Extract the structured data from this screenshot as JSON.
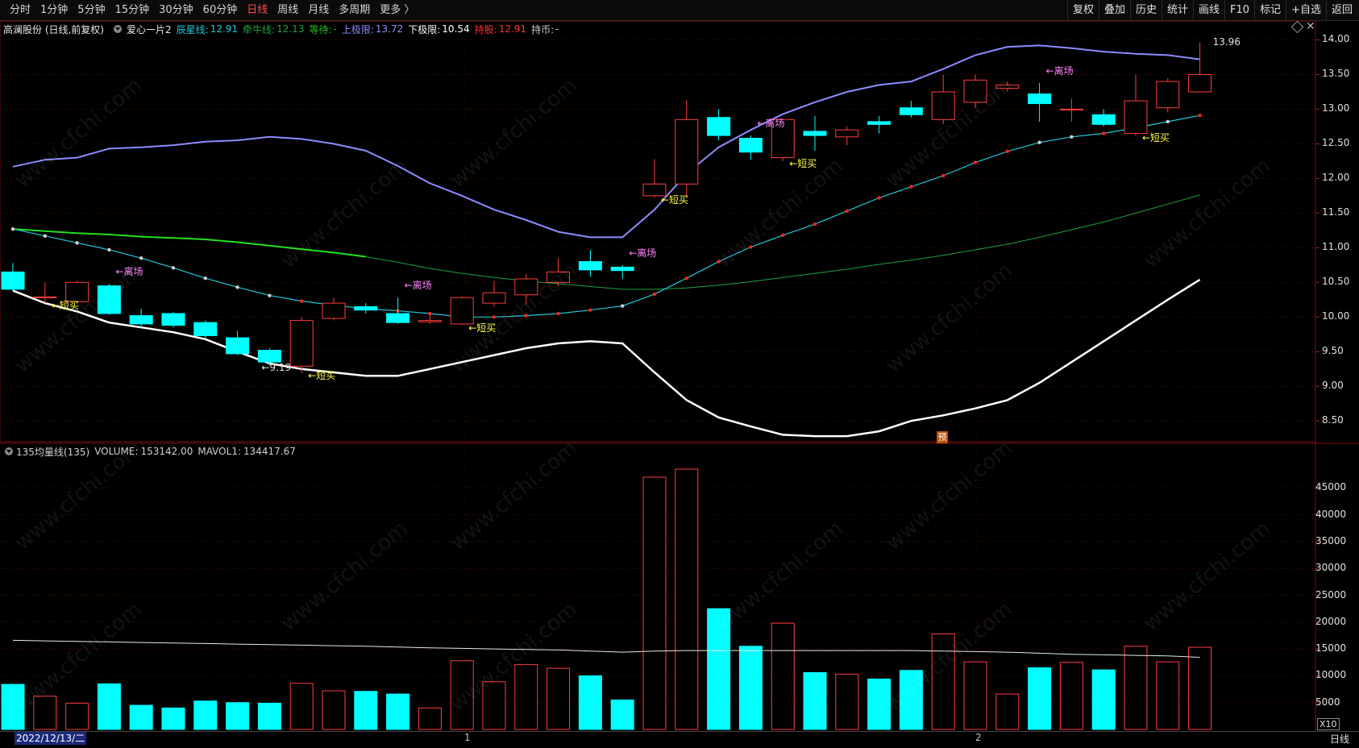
{
  "toolbar": {
    "left": [
      {
        "label": "分时",
        "active": false
      },
      {
        "label": "1分钟",
        "active": false
      },
      {
        "label": "5分钟",
        "active": false
      },
      {
        "label": "15分钟",
        "active": false
      },
      {
        "label": "30分钟",
        "active": false
      },
      {
        "label": "60分钟",
        "active": false
      },
      {
        "label": "日线",
        "active": true
      },
      {
        "label": "周线",
        "active": false
      },
      {
        "label": "月线",
        "active": false
      },
      {
        "label": "多周期",
        "active": false
      },
      {
        "label": "更多 〉",
        "active": false
      }
    ],
    "right": [
      "复权",
      "叠加",
      "历史",
      "统计",
      "画线",
      "F10",
      "标记",
      "+自选",
      "返回"
    ]
  },
  "info": {
    "stock": "高澜股份 (日线,前复权)",
    "indicator": "爱心一片2",
    "chenxing_label": "辰星线:",
    "chenxing_value": "12.91",
    "qianniu_label": "牵牛线:",
    "qianniu_value": "12.13",
    "dengdai_label": "等待:",
    "dengdai_value": "-",
    "upper_label": "上极限:",
    "upper_value": "13.72",
    "lower_label": "下极限:",
    "lower_value": "10.54",
    "hold_label": "持股:",
    "hold_value": "12.91",
    "coin_label": "持币:",
    "coin_value": "-"
  },
  "volume_info": {
    "name": "135均量线(135)",
    "volume_label": "VOLUME:",
    "volume_value": "153142.00",
    "mavol_label": "MAVOL1:",
    "mavol_value": "134417.67"
  },
  "price_axis": [
    "14.00",
    "13.50",
    "13.00",
    "12.50",
    "12.00",
    "11.50",
    "11.00",
    "10.50",
    "10.00",
    "9.50",
    "9.00",
    "8.50"
  ],
  "volume_axis": [
    "45000",
    "40000",
    "35000",
    "30000",
    "25000",
    "20000",
    "15000",
    "10000",
    "5000"
  ],
  "x10_label": "X10",
  "bottom": {
    "date": "2022/12/13/二",
    "month1": "1",
    "month2": "2",
    "period": "日线"
  },
  "badge_yu": "预",
  "watermark": "www.cfchi.com",
  "colors": {
    "up": "#ff3c3c",
    "down": "#00ffff",
    "upper": "#8c8cff",
    "lower": "#ffffff",
    "chenxing": "#20c8d8",
    "qianniu": "#20a040",
    "buy": "#ffff40",
    "sell": "#ff80ff"
  },
  "chart_data": {
    "type": "candlestick",
    "price_range": [
      8.2,
      14.25
    ],
    "volume_range": [
      0,
      50000
    ],
    "candles": [
      {
        "o": 10.65,
        "h": 10.78,
        "l": 10.38,
        "c": 10.4,
        "v": 8400
      },
      {
        "o": 10.29,
        "h": 10.5,
        "l": 10.2,
        "c": 10.29,
        "v": 6200
      },
      {
        "o": 10.22,
        "h": 10.52,
        "l": 10.2,
        "c": 10.5,
        "v": 4900
      },
      {
        "o": 10.45,
        "h": 10.48,
        "l": 10.03,
        "c": 10.05,
        "v": 8500
      },
      {
        "o": 10.02,
        "h": 10.12,
        "l": 9.85,
        "c": 9.9,
        "v": 4500
      },
      {
        "o": 10.05,
        "h": 10.07,
        "l": 9.85,
        "c": 9.88,
        "v": 4000
      },
      {
        "o": 9.92,
        "h": 9.95,
        "l": 9.7,
        "c": 9.73,
        "v": 5300
      },
      {
        "o": 9.7,
        "h": 9.8,
        "l": 9.45,
        "c": 9.47,
        "v": 5000
      },
      {
        "o": 9.52,
        "h": 9.55,
        "l": 9.3,
        "c": 9.35,
        "v": 4900
      },
      {
        "o": 9.29,
        "h": 10.0,
        "l": 9.19,
        "c": 9.95,
        "v": 8600
      },
      {
        "o": 9.98,
        "h": 10.28,
        "l": 9.95,
        "c": 10.2,
        "v": 7200
      },
      {
        "o": 10.15,
        "h": 10.2,
        "l": 10.05,
        "c": 10.1,
        "v": 7100
      },
      {
        "o": 10.05,
        "h": 10.28,
        "l": 9.9,
        "c": 9.92,
        "v": 6600
      },
      {
        "o": 9.93,
        "h": 10.05,
        "l": 9.9,
        "c": 9.95,
        "v": 4000
      },
      {
        "o": 9.9,
        "h": 10.3,
        "l": 9.88,
        "c": 10.28,
        "v": 12800
      },
      {
        "o": 10.2,
        "h": 10.52,
        "l": 10.15,
        "c": 10.35,
        "v": 8900
      },
      {
        "o": 10.32,
        "h": 10.62,
        "l": 10.18,
        "c": 10.55,
        "v": 12100
      },
      {
        "o": 10.5,
        "h": 10.85,
        "l": 10.45,
        "c": 10.65,
        "v": 11400
      },
      {
        "o": 10.8,
        "h": 10.97,
        "l": 10.58,
        "c": 10.68,
        "v": 10000
      },
      {
        "o": 10.72,
        "h": 10.75,
        "l": 10.55,
        "c": 10.67,
        "v": 5500
      },
      {
        "o": 11.75,
        "h": 12.28,
        "l": 11.72,
        "c": 11.92,
        "v": 47000
      },
      {
        "o": 11.92,
        "h": 13.13,
        "l": 11.72,
        "c": 12.85,
        "v": 48500
      },
      {
        "o": 12.88,
        "h": 13.0,
        "l": 12.55,
        "c": 12.62,
        "v": 22500
      },
      {
        "o": 12.58,
        "h": 12.62,
        "l": 12.27,
        "c": 12.38,
        "v": 15500
      },
      {
        "o": 12.3,
        "h": 12.85,
        "l": 12.25,
        "c": 12.85,
        "v": 19800
      },
      {
        "o": 12.68,
        "h": 12.9,
        "l": 12.4,
        "c": 12.62,
        "v": 10600
      },
      {
        "o": 12.6,
        "h": 12.75,
        "l": 12.48,
        "c": 12.7,
        "v": 10300
      },
      {
        "o": 12.82,
        "h": 12.9,
        "l": 12.65,
        "c": 12.78,
        "v": 9400
      },
      {
        "o": 13.02,
        "h": 13.12,
        "l": 12.88,
        "c": 12.92,
        "v": 11000
      },
      {
        "o": 12.85,
        "h": 13.5,
        "l": 12.78,
        "c": 13.25,
        "v": 17800
      },
      {
        "o": 13.1,
        "h": 13.5,
        "l": 13.02,
        "c": 13.42,
        "v": 12600
      },
      {
        "o": 13.3,
        "h": 13.4,
        "l": 13.25,
        "c": 13.35,
        "v": 6600
      },
      {
        "o": 13.22,
        "h": 13.38,
        "l": 12.82,
        "c": 13.08,
        "v": 11500
      },
      {
        "o": 13.0,
        "h": 13.15,
        "l": 12.82,
        "c": 13.0,
        "v": 12500
      },
      {
        "o": 12.92,
        "h": 13.0,
        "l": 12.75,
        "c": 12.78,
        "v": 11100
      },
      {
        "o": 12.65,
        "h": 13.5,
        "l": 12.62,
        "c": 13.12,
        "v": 15500
      },
      {
        "o": 13.02,
        "h": 13.45,
        "l": 12.95,
        "c": 13.4,
        "v": 12600
      },
      {
        "o": 13.25,
        "h": 13.96,
        "l": 13.25,
        "c": 13.5,
        "v": 15314
      }
    ],
    "upper": [
      12.17,
      12.27,
      12.3,
      12.43,
      12.45,
      12.48,
      12.53,
      12.55,
      12.6,
      12.57,
      12.5,
      12.4,
      12.18,
      11.93,
      11.75,
      11.55,
      11.4,
      11.23,
      11.15,
      11.15,
      11.55,
      12.07,
      12.45,
      12.7,
      12.93,
      13.1,
      13.25,
      13.35,
      13.4,
      13.58,
      13.78,
      13.9,
      13.92,
      13.88,
      13.83,
      13.8,
      13.78,
      13.72
    ],
    "lower": [
      10.38,
      10.2,
      10.08,
      9.92,
      9.85,
      9.78,
      9.68,
      9.5,
      9.33,
      9.25,
      9.2,
      9.15,
      9.15,
      9.25,
      9.35,
      9.45,
      9.55,
      9.62,
      9.65,
      9.62,
      9.2,
      8.8,
      8.55,
      8.42,
      8.3,
      8.28,
      8.28,
      8.35,
      8.5,
      8.58,
      8.68,
      8.8,
      9.05,
      9.35,
      9.65,
      9.95,
      10.25,
      10.54
    ],
    "chenxing": [
      11.27,
      11.17,
      11.07,
      10.97,
      10.85,
      10.71,
      10.56,
      10.43,
      10.31,
      10.23,
      10.17,
      10.12,
      10.09,
      10.05,
      10.0,
      10.0,
      10.02,
      10.05,
      10.1,
      10.16,
      10.33,
      10.56,
      10.8,
      11.01,
      11.18,
      11.34,
      11.53,
      11.72,
      11.88,
      12.04,
      12.23,
      12.39,
      12.52,
      12.6,
      12.65,
      12.73,
      12.82,
      12.91
    ],
    "qianniu": [
      11.27,
      11.24,
      11.21,
      11.19,
      11.16,
      11.14,
      11.12,
      11.08,
      11.03,
      10.98,
      10.93,
      10.87,
      10.79,
      10.7,
      10.63,
      10.57,
      10.52,
      10.48,
      10.44,
      10.4,
      10.4,
      10.42,
      10.46,
      10.51,
      10.57,
      10.63,
      10.69,
      10.76,
      10.82,
      10.89,
      10.97,
      11.05,
      11.15,
      11.26,
      11.37,
      11.5,
      11.63,
      11.76
    ],
    "mavol": [
      16600,
      16500,
      16400,
      16300,
      16200,
      16100,
      16000,
      15900,
      15800,
      15700,
      15600,
      15500,
      15350,
      15200,
      15100,
      15000,
      14900,
      14800,
      14600,
      14400,
      14600,
      14700,
      14700,
      14700,
      14700,
      14700,
      14700,
      14700,
      14700,
      14600,
      14500,
      14400,
      14200,
      14000,
      13900,
      13800,
      13700,
      13442
    ],
    "annotations": [
      {
        "i": 1,
        "text": "←短买",
        "kind": "buy"
      },
      {
        "i": 3,
        "text": "←离场",
        "kind": "sell"
      },
      {
        "i": 8,
        "text": "←9.19",
        "kind": "val"
      },
      {
        "i": 9,
        "text": "←短买",
        "kind": "buy"
      },
      {
        "i": 12,
        "text": "←离场",
        "kind": "sell"
      },
      {
        "i": 14,
        "text": "←短买",
        "kind": "buy"
      },
      {
        "i": 19,
        "text": "←离场",
        "kind": "sell"
      },
      {
        "i": 20,
        "text": "←短买",
        "kind": "buy"
      },
      {
        "i": 23,
        "text": "←离场",
        "kind": "sell"
      },
      {
        "i": 24,
        "text": "←短买",
        "kind": "buy"
      },
      {
        "i": 32,
        "text": "←离场",
        "kind": "sell"
      },
      {
        "i": 35,
        "text": "←短买",
        "kind": "buy"
      },
      {
        "i": 37,
        "text": "13.96",
        "kind": "val"
      }
    ]
  }
}
